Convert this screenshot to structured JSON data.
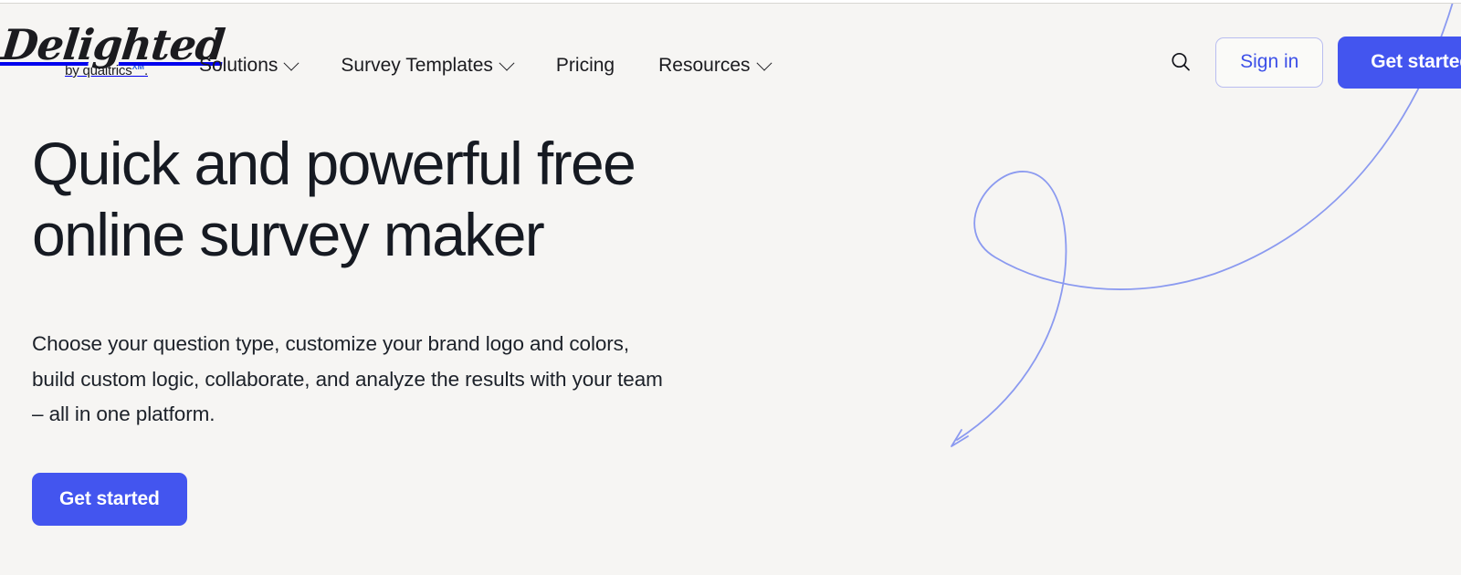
{
  "theme": {
    "background": "#f6f5f3",
    "accent_blue": "#4355ef",
    "link_blue": "#3d50e8",
    "text_dark": "#161a22",
    "swoosh_blue": "#8b9af0",
    "xm_blue": "#2f5fe0"
  },
  "header": {
    "logo": {
      "wordmark": "Delighted",
      "byline": "by qualtrics",
      "byline_suffix": ".",
      "superscript": "XM"
    },
    "nav": [
      {
        "label": "Solutions",
        "has_dropdown": true
      },
      {
        "label": "Survey Templates",
        "has_dropdown": true
      },
      {
        "label": "Pricing",
        "has_dropdown": false
      },
      {
        "label": "Resources",
        "has_dropdown": true
      }
    ],
    "search_icon": "search-icon",
    "signin_label": "Sign in",
    "get_started_label": "Get started"
  },
  "hero": {
    "title_line1": "Quick and powerful free",
    "title_line2": "online survey maker",
    "subtitle_line1": "Choose your question type, customize your brand logo and colors,",
    "subtitle_line2": "build custom logic, collaborate, and analyze the results with your team",
    "subtitle_line3": "– all in one platform.",
    "cta_label": "Get started"
  },
  "decoration": {
    "swoosh_name": "curved-arrow-swoosh",
    "arrow_direction": "down-left"
  }
}
